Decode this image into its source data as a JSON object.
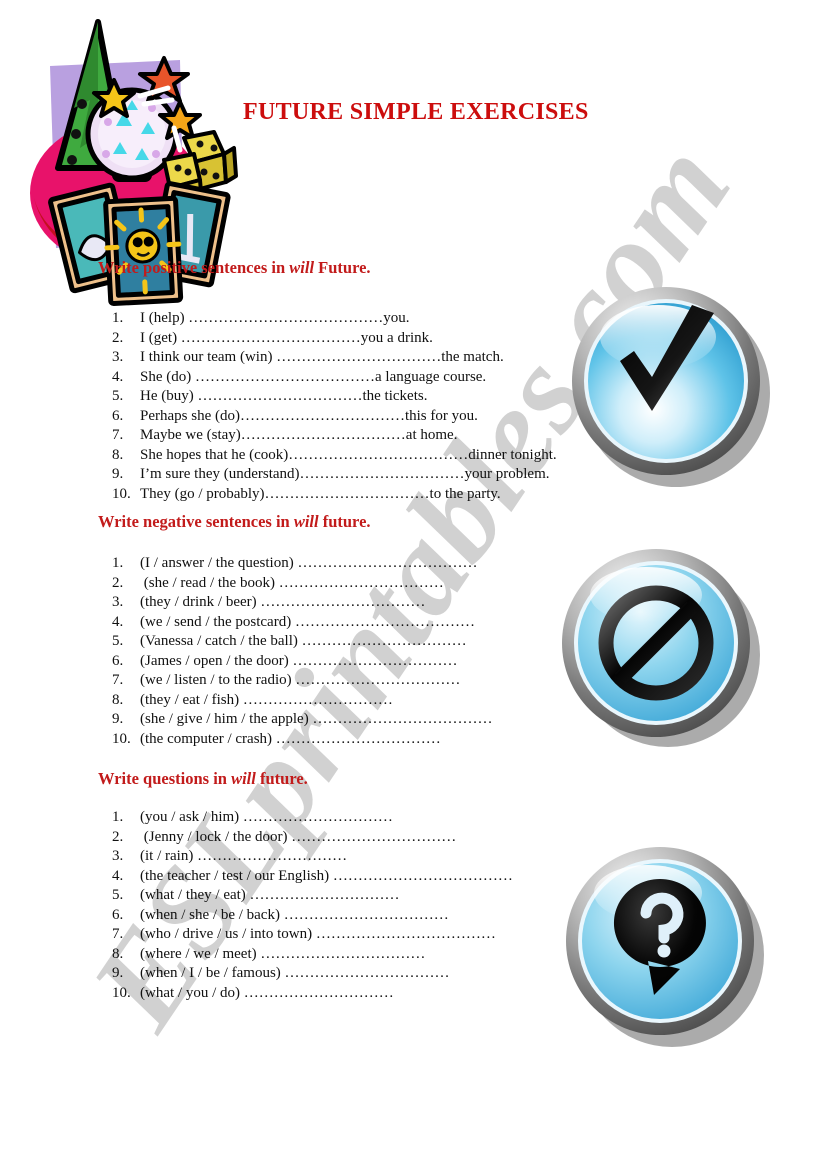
{
  "document": {
    "title": "FUTURE SIMPLE EXERCISES",
    "watermark": "ESLprintables.com",
    "accent_color": "#cc0d0d",
    "heading_color": "#c21b1b",
    "body_color": "#111111",
    "page_background": "#ffffff"
  },
  "clipart": {
    "name": "fortune-teller-crystal-ball-clipart",
    "colors": {
      "backdrop": "#b9a0e0",
      "table": "#e8126a",
      "hat": "#3faa3f",
      "ball": "#efe0f5",
      "dice": "#ecd84a",
      "card": "#4ab9b9",
      "star": "#f5c518"
    }
  },
  "sections": [
    {
      "id": "positive",
      "heading": {
        "before": "Write positive sentences in ",
        "emphasis": "will",
        "after": " Future."
      },
      "icon": {
        "name": "checkmark-button",
        "glyph": "check"
      },
      "items": [
        {
          "n": "1.",
          "text": "I (help) …………………………………you."
        },
        {
          "n": "2.",
          "text": "I (get) ………………………………you a drink."
        },
        {
          "n": "3.",
          "text": "I think our team (win) ……………………………the match."
        },
        {
          "n": "4.",
          "text": "She (do) ………………………………a language course."
        },
        {
          "n": "5.",
          "text": "He (buy) ……………………………the tickets."
        },
        {
          "n": "6.",
          "text": "Perhaps she (do)……………………………this for you."
        },
        {
          "n": "7.",
          "text": "Maybe we (stay)……………………………at home."
        },
        {
          "n": "8.",
          "text": "She hopes that he (cook)………………………………dinner tonight."
        },
        {
          "n": "9.",
          "text": "I’m sure they (understand)……………………………your problem."
        },
        {
          "n": "10.",
          "text": "They (go / probably)……………………………to the party."
        }
      ]
    },
    {
      "id": "negative",
      "heading": {
        "before": "Write negative sentences in ",
        "emphasis": "will",
        "after": " future."
      },
      "icon": {
        "name": "prohibition-button",
        "glyph": "no-entry"
      },
      "items": [
        {
          "n": "1.",
          "text": "(I / answer / the question) ………………………………"
        },
        {
          "n": "2.",
          "text": " (she / read / the book) ……………………………"
        },
        {
          "n": "3.",
          "text": "(they / drink / beer) ……………………………"
        },
        {
          "n": "4.",
          "text": "(we / send / the postcard) ………………………………"
        },
        {
          "n": "5.",
          "text": "(Vanessa / catch / the ball) ……………………………"
        },
        {
          "n": "6.",
          "text": "(James / open / the door) ……………………………"
        },
        {
          "n": "7.",
          "text": "(we / listen / to the radio) ……………………………"
        },
        {
          "n": "8.",
          "text": "(they / eat / fish) …………………………"
        },
        {
          "n": "9.",
          "text": "(she / give / him / the apple) ………………………………"
        },
        {
          "n": "10.",
          "text": "(the computer / crash) ……………………………"
        }
      ]
    },
    {
      "id": "questions",
      "heading": {
        "before": "Write questions in ",
        "emphasis": "will",
        "after": " future."
      },
      "icon": {
        "name": "question-bubble-button",
        "glyph": "question"
      },
      "items": [
        {
          "n": "1.",
          "text": "(you / ask / him) …………………………"
        },
        {
          "n": "2.",
          "text": " (Jenny / lock / the door) ……………………………"
        },
        {
          "n": "3.",
          "text": "(it / rain) …………………………"
        },
        {
          "n": "4.",
          "text": "(the teacher / test / our English) ………………………………"
        },
        {
          "n": "5.",
          "text": "(what / they / eat) …………………………"
        },
        {
          "n": "6.",
          "text": "(when / she / be / back) ……………………………"
        },
        {
          "n": "7.",
          "text": "(who / drive / us / into town) ………………………………"
        },
        {
          "n": "8.",
          "text": "(where / we / meet) ……………………………"
        },
        {
          "n": "9.",
          "text": "(when / I / be / famous) ……………………………"
        },
        {
          "n": "10.",
          "text": "(what / you / do) …………………………"
        }
      ]
    }
  ]
}
